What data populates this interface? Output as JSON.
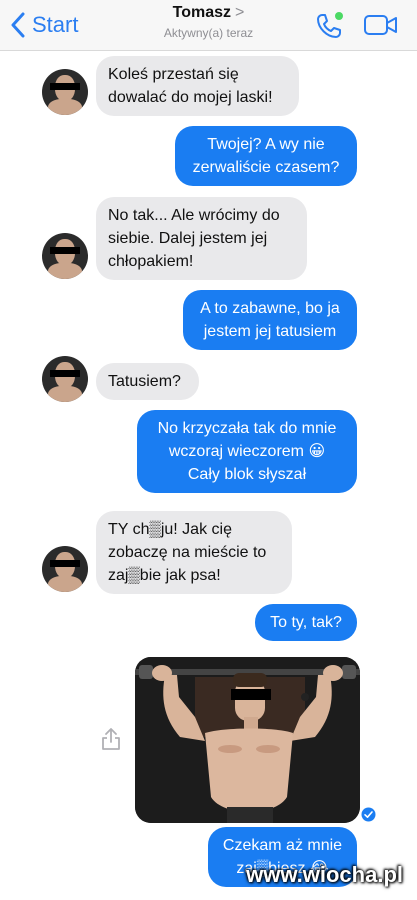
{
  "header": {
    "back_label": "Start",
    "contact_name": "Tomasz",
    "contact_chevron": ">",
    "contact_status": "Aktywny(a) teraz",
    "accent_color": "#2b7ef1",
    "online_color": "#4cd964"
  },
  "messages": [
    {
      "side": "in",
      "text": "Koleś przestań się\ndowalać do mojej laski!"
    },
    {
      "side": "out",
      "text": "Twojej? A wy nie\nzerwaliście czasem?"
    },
    {
      "side": "in",
      "text": "No tak... Ale wrócimy do\nsiebie. Dalej jestem jej\nchłopakiem!"
    },
    {
      "side": "out",
      "text": "A to zabawne, bo ja\njestem jej tatusiem"
    },
    {
      "side": "in",
      "text": "Tatusiem?"
    },
    {
      "side": "out",
      "text": "No krzyczała tak do mnie\nwczoraj wieczorem 😀\nCały blok słyszał"
    },
    {
      "side": "in",
      "text": "TY ch▒ju! Jak cię\nzobaczę na mieście to\nzaj▒bie jak psa!"
    },
    {
      "side": "out",
      "text": "To ty, tak?"
    },
    {
      "side": "out",
      "text": "Czekam aż mnie\nzaj▒biesz 😂"
    }
  ],
  "colors": {
    "incoming_bubble": "#e9e9eb",
    "outgoing_bubble": "#1a7df2"
  },
  "icons": {
    "back": "chevron-left-icon",
    "call": "phone-icon",
    "video": "video-camera-icon",
    "share": "share-icon",
    "read": "check-circle-icon"
  },
  "watermark": "www.wiocha.pl"
}
